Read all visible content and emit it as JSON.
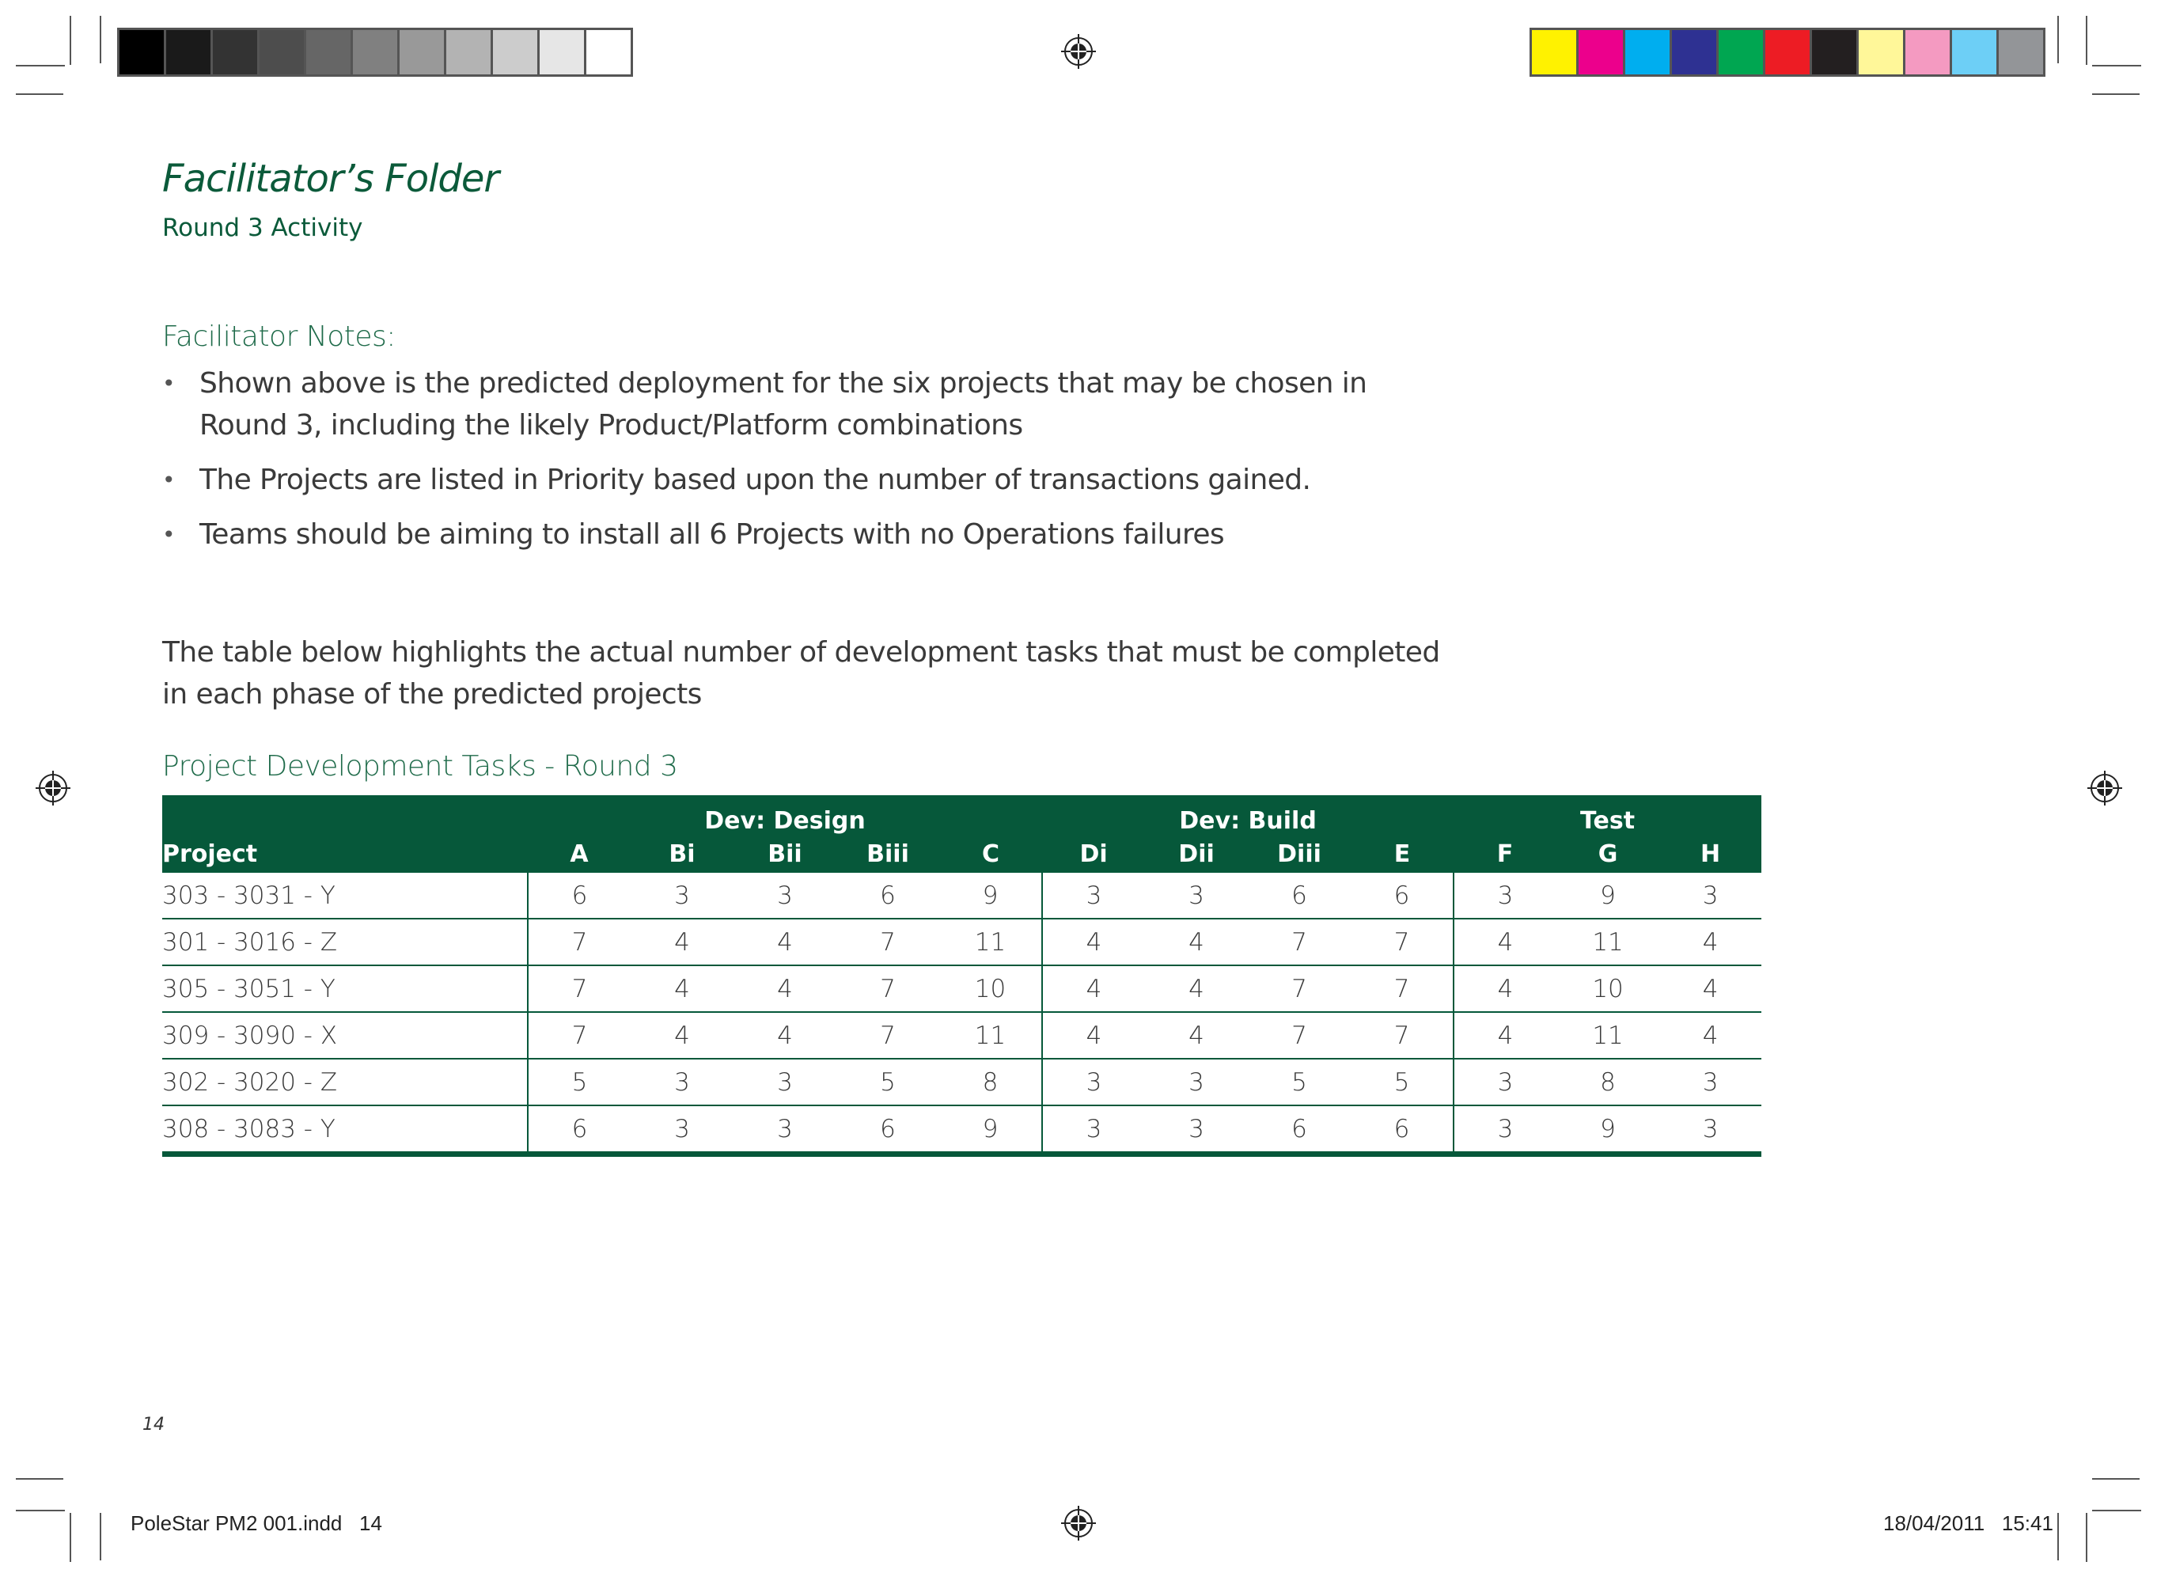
{
  "header": {
    "title": "Facilitator’s Folder",
    "subtitle": "Round 3 Activity"
  },
  "notes": {
    "heading": "Facilitator Notes:",
    "items": [
      "Shown above is the predicted deployment for the six projects that may be chosen in Round 3, including the likely Product/Platform combinations",
      "The Projects are listed in Priority based upon the number of transactions gained.",
      "Teams should be aiming to install all 6 Projects with no Operations failures"
    ]
  },
  "intro_text": "The table below highlights the actual number of development tasks that must be completed in each phase of the predicted projects",
  "table": {
    "title": "Project Development Tasks - Round 3",
    "project_header": "Project",
    "groups": [
      "Dev: Design",
      "Dev: Build",
      "Test"
    ],
    "columns": [
      "A",
      "Bi",
      "Bii",
      "Biii",
      "C",
      "Di",
      "Dii",
      "Diii",
      "E",
      "F",
      "G",
      "H"
    ],
    "rows": [
      {
        "project": "303 - 3031 - Y",
        "values": [
          "6",
          "3",
          "3",
          "6",
          "9",
          "3",
          "3",
          "6",
          "6",
          "3",
          "9",
          "3"
        ]
      },
      {
        "project": "301 - 3016 - Z",
        "values": [
          "7",
          "4",
          "4",
          "7",
          "11",
          "4",
          "4",
          "7",
          "7",
          "4",
          "11",
          "4"
        ]
      },
      {
        "project": "305 - 3051 - Y",
        "values": [
          "7",
          "4",
          "4",
          "7",
          "10",
          "4",
          "4",
          "7",
          "7",
          "4",
          "10",
          "4"
        ]
      },
      {
        "project": "309 - 3090 - X",
        "values": [
          "7",
          "4",
          "4",
          "7",
          "11",
          "4",
          "4",
          "7",
          "7",
          "4",
          "11",
          "4"
        ]
      },
      {
        "project": "302 - 3020 - Z",
        "values": [
          "5",
          "3",
          "3",
          "5",
          "8",
          "3",
          "3",
          "5",
          "5",
          "3",
          "8",
          "3"
        ]
      },
      {
        "project": "308 - 3083 - Y",
        "values": [
          "6",
          "3",
          "3",
          "6",
          "9",
          "3",
          "3",
          "6",
          "6",
          "3",
          "9",
          "3"
        ]
      }
    ]
  },
  "page_number": "14",
  "slug": {
    "file": "PoleStar PM2 001.indd   14",
    "datetime": "18/04/2011   15:41"
  },
  "colors": {
    "accent": "#06583a",
    "gray_bar": [
      "#000000",
      "#1a1a1a",
      "#333333",
      "#4d4d4d",
      "#666666",
      "#808080",
      "#999999",
      "#b3b3b3",
      "#cccccc",
      "#e6e6e6",
      "#ffffff"
    ],
    "color_bar": [
      "#fff200",
      "#ec008c",
      "#00aeef",
      "#2e3192",
      "#00a651",
      "#ed1c24",
      "#231f20",
      "#fff799",
      "#f49ac1",
      "#6dcff6",
      "#939598"
    ]
  }
}
